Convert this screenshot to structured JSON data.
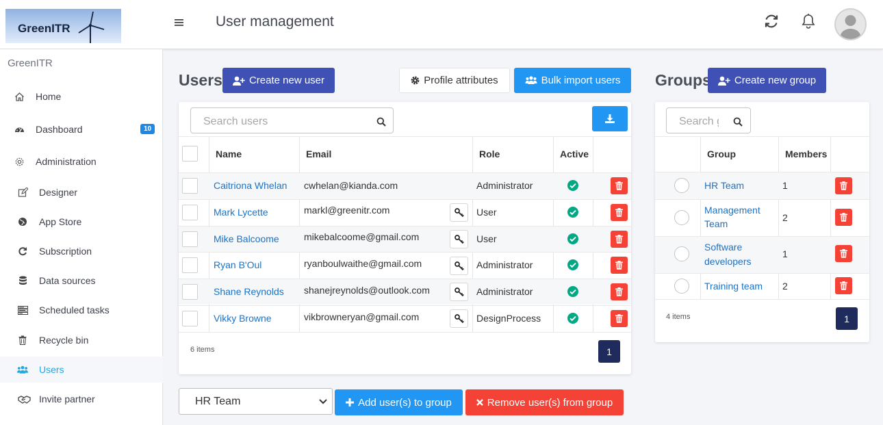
{
  "header": {
    "logo_text": "GreenITR",
    "title": "User management",
    "icons": [
      "menu-icon",
      "refresh-icon",
      "bell-icon",
      "avatar"
    ]
  },
  "sidebar": {
    "brand": "GreenITR",
    "items": [
      {
        "label": "Home",
        "icon": "home-icon"
      },
      {
        "label": "Dashboard",
        "icon": "dashboard-icon",
        "badge": "10"
      },
      {
        "label": "Administration",
        "icon": "gear-icon"
      },
      {
        "label": "Designer",
        "icon": "edit-icon"
      },
      {
        "label": "App Store",
        "icon": "globe-icon"
      },
      {
        "label": "Subscription",
        "icon": "refresh-icon"
      },
      {
        "label": "Data sources",
        "icon": "database-icon"
      },
      {
        "label": "Scheduled tasks",
        "icon": "tasks-icon"
      },
      {
        "label": "Recycle bin",
        "icon": "trash-icon"
      },
      {
        "label": "Users",
        "icon": "users-icon",
        "active": true
      },
      {
        "label": "Invite partner",
        "icon": "handshake-icon"
      }
    ]
  },
  "users": {
    "title": "Users",
    "create_label": "Create new user",
    "profile_label": "Profile attributes",
    "bulk_label": "Bulk import users",
    "search_placeholder": "Search users",
    "columns": [
      "Name",
      "Email",
      "Role",
      "Active"
    ],
    "rows": [
      {
        "name": "Caitriona Whelan",
        "email": "cwhelan@kianda.com",
        "role": "Administrator",
        "active": true,
        "key": false
      },
      {
        "name": "Mark Lycette",
        "email": "markl@greenitr.com",
        "role": "User",
        "active": true,
        "key": true
      },
      {
        "name": "Mike Balcoome",
        "email": "mikebalcoome@gmail.com",
        "role": "User",
        "active": true,
        "key": true
      },
      {
        "name": "Ryan B'Oul",
        "email": "ryanboulwaithe@gmail.com",
        "role": "Administrator",
        "active": true,
        "key": true
      },
      {
        "name": "Shane Reynolds",
        "email": "shanejreynolds@outlook.com",
        "role": "Administrator",
        "active": true,
        "key": true
      },
      {
        "name": "Vikky Browne",
        "email": "vikbrowneryan@gmail.com",
        "role": "DesignProcess",
        "active": true,
        "key": true
      }
    ],
    "items_count": "6 items",
    "page": "1"
  },
  "groups": {
    "title": "Groups",
    "create_label": "Create new group",
    "search_placeholder": "Search groups",
    "columns": [
      "Group",
      "Members"
    ],
    "rows": [
      {
        "line1": "HR Team",
        "line2": "",
        "members": "1"
      },
      {
        "line1": "Management",
        "line2": "Team",
        "members": "2"
      },
      {
        "line1": "Software",
        "line2": "developers",
        "members": "1"
      },
      {
        "line1": "Training team",
        "line2": "",
        "members": "2"
      }
    ],
    "items_count": "4 items",
    "page": "1"
  },
  "footer": {
    "selected_group": "HR Team",
    "add_label": "Add user(s) to group",
    "remove_label": "Remove user(s) from group"
  },
  "colors": {
    "navy_button": "#3f51b5",
    "blue_button": "#2196f3",
    "red_button": "#f44336",
    "link": "#1a73c8",
    "active_sidebar": "#1ea7e1",
    "check_green": "#00a884",
    "pager": "#1f2b5c"
  }
}
